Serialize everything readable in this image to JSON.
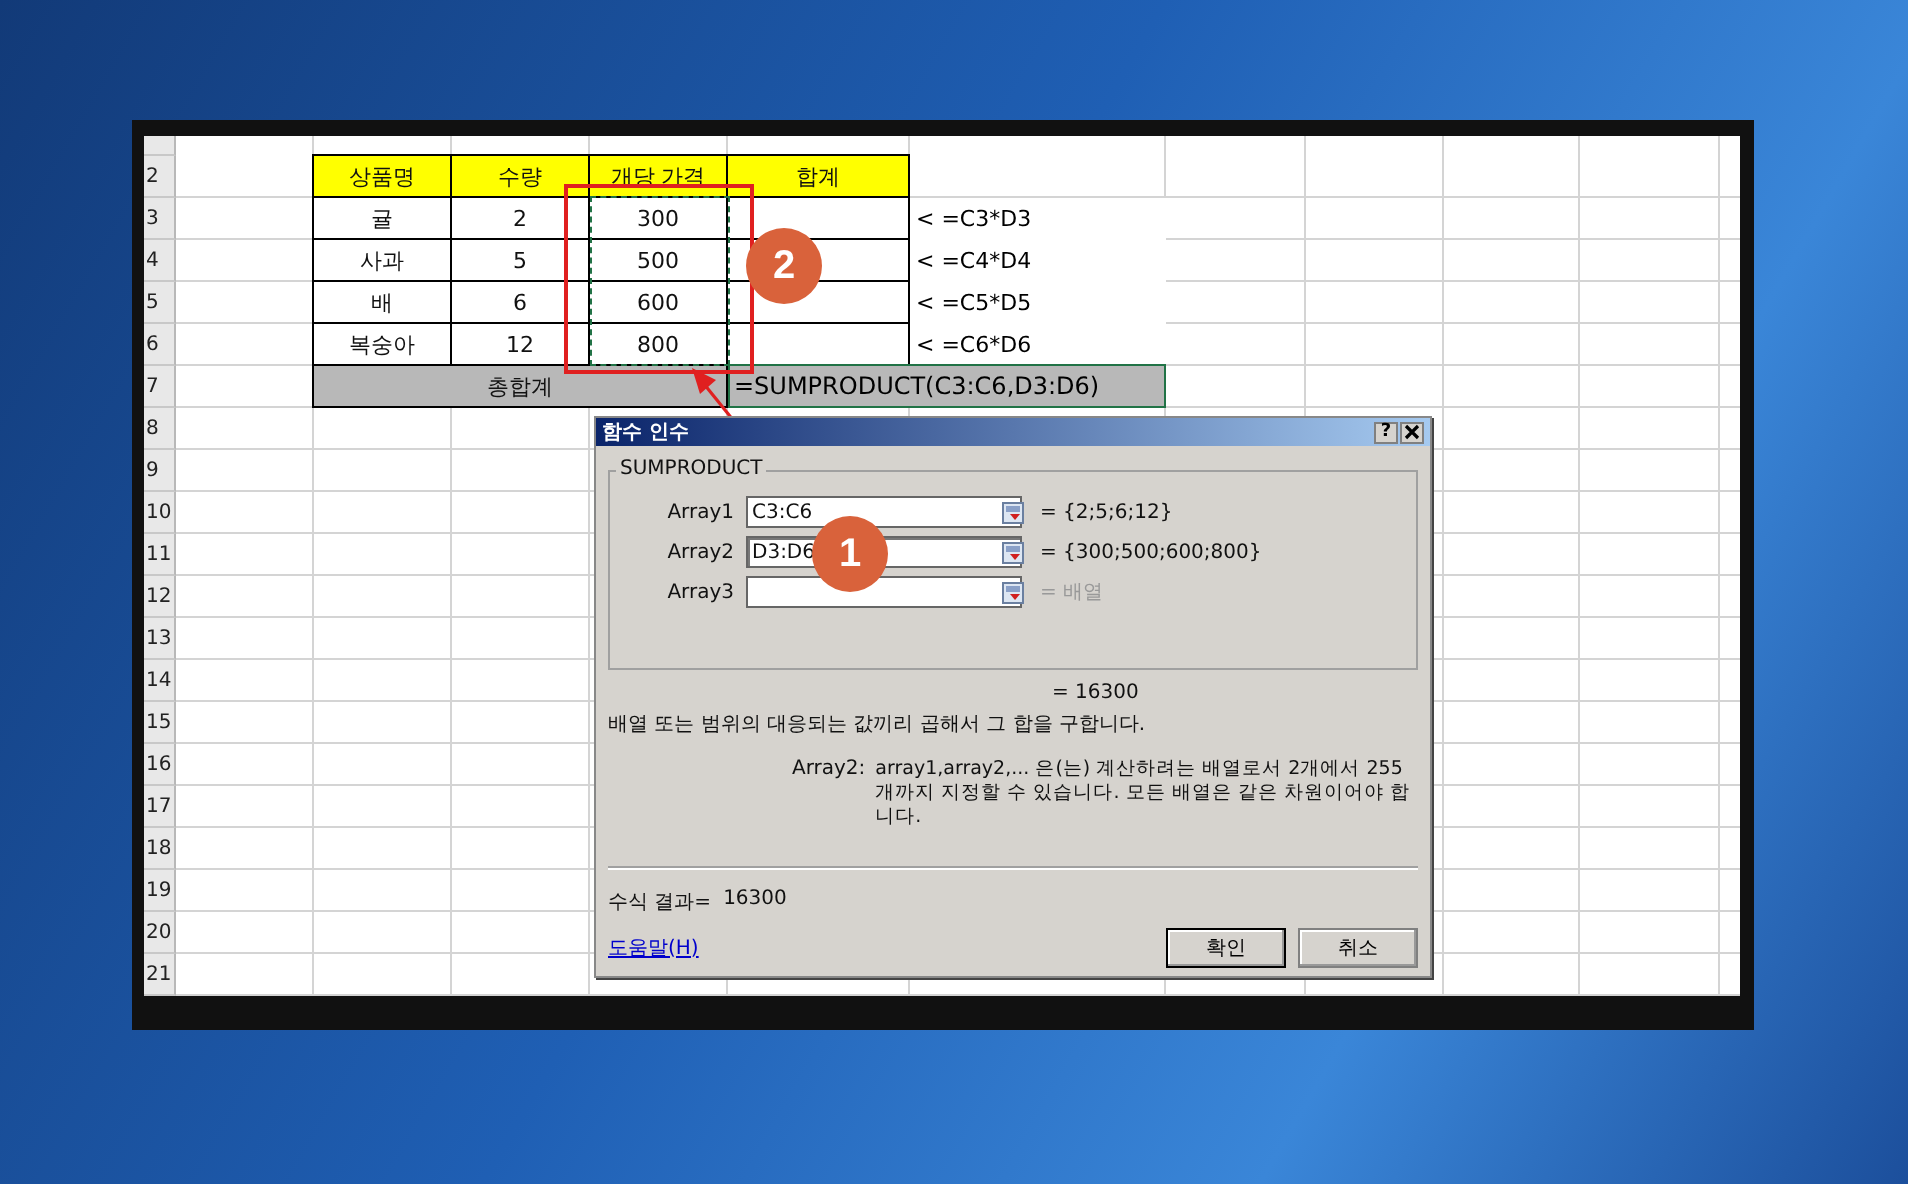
{
  "sheet": {
    "row_numbers": [
      "2",
      "3",
      "4",
      "5",
      "6",
      "7",
      "8",
      "9",
      "10",
      "11",
      "12",
      "13",
      "14",
      "15",
      "16",
      "17",
      "18",
      "19",
      "20",
      "21"
    ],
    "table": {
      "header": [
        "상품명",
        "수량",
        "개당 가격",
        "합계"
      ],
      "rows": [
        [
          "귤",
          "2",
          "300",
          ""
        ],
        [
          "사과",
          "5",
          "500",
          ""
        ],
        [
          "배",
          "6",
          "600",
          ""
        ],
        [
          "복숭아",
          "12",
          "800",
          ""
        ]
      ],
      "total_label": "총합계",
      "total_formula": "=SUMPRODUCT(C3:C6,D3:D6)"
    },
    "notes": [
      "<  =C3*D3",
      "<  =C4*D4",
      "<  =C5*D5",
      "<  =C6*D6"
    ]
  },
  "dialog": {
    "title": "함수 인수",
    "help_button": "?",
    "function_name": "SUMPRODUCT",
    "arguments": [
      {
        "label": "Array1",
        "value": "C3:C6",
        "focused": false,
        "result": "= {2;5;6;12}",
        "result_muted": false
      },
      {
        "label": "Array2",
        "value": "D3:D6",
        "focused": true,
        "result": "= {300;500;600;800}",
        "result_muted": false
      },
      {
        "label": "Array3",
        "focused": false,
        "result": "= 배열",
        "result_muted": true
      }
    ],
    "formula_value": "= 16300",
    "description": "배열 또는 범위의 대응되는 값끼리 곱해서 그 합을 구합니다.",
    "arg_help_name": "Array2:",
    "arg_help_text": "array1,array2,... 은(는) 계산하려는 배열로서 2개에서 255개까지 지정할 수 있습니다. 모든 배열은 같은 차원이어야 합니다.",
    "result_label": "수식 결과=",
    "result_value": "16300",
    "help_link": "도움말(H)",
    "buttons": [
      "확인",
      "취소"
    ]
  },
  "callouts": [
    "1",
    "2"
  ]
}
